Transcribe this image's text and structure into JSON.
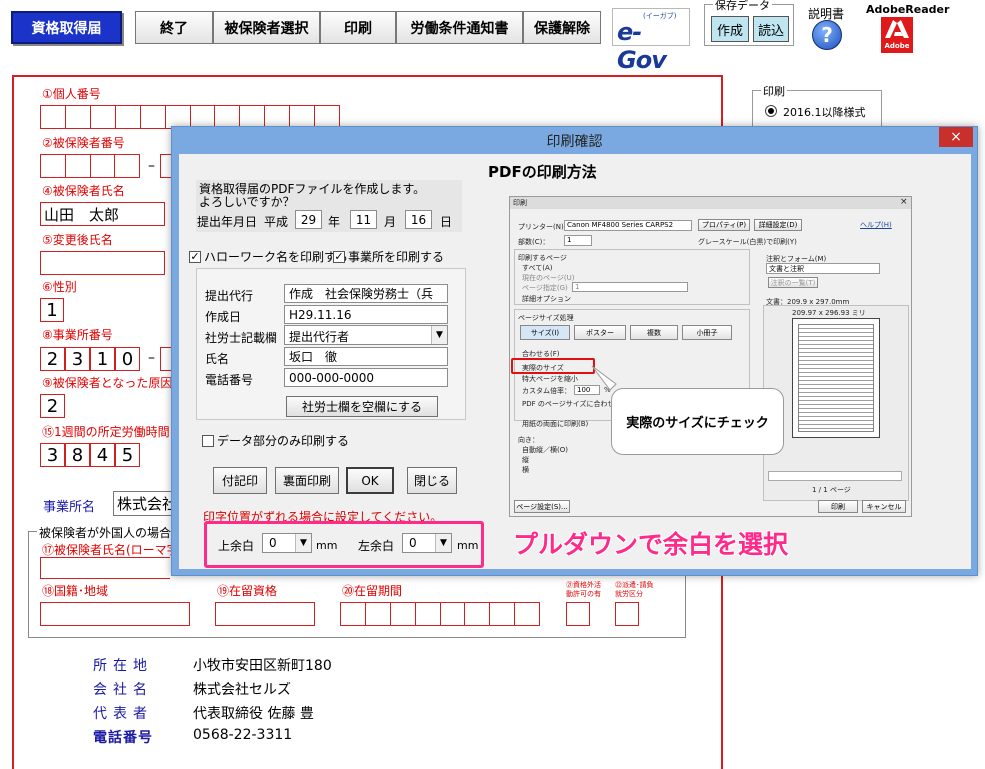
{
  "toolbar": {
    "active_tab": "資格取得届",
    "buttons": [
      "終了",
      "被保険者選択",
      "印刷",
      "労働条件通知書",
      "保護解除"
    ],
    "egov_logo": "e-Gov",
    "egov_sub": "(イーガブ)",
    "save_data_label": "保存データ",
    "create_label": "作成",
    "read_label": "読込",
    "manual_label": "説明書",
    "adobe_label": "AdobeReader",
    "adobe_sub": "Adobe"
  },
  "form": {
    "individual_number_label": "①個人番号",
    "insured_number_label": "②被保険者番号",
    "insured_name_label": "④被保険者氏名",
    "insured_name_value": "山田　太郎",
    "changed_name_label": "⑤変更後氏名",
    "gender_label": "⑥性別",
    "gender_value": "1",
    "office_number_label": "⑧事業所番号",
    "office_digits": [
      "2",
      "3",
      "1",
      "0"
    ],
    "reason_label": "⑨被保険者となった原因",
    "reason_value": "2",
    "weekly_hours_label": "⑮1週間の所定労働時間",
    "weekly_hours_digits": [
      "3",
      "8",
      "4",
      "5"
    ],
    "office_name_label": "事業所名",
    "office_name_value": "株式会社",
    "foreign_section_label": "被保険者が外国人の場合(",
    "roman_name_label": "⑰被保険者氏名(ローマ字",
    "nationality_label": "⑱国籍･地域",
    "residence_status_label": "⑲在留資格",
    "residence_period_label": "⑳在留期間",
    "activity_permit_label": "㉑資格外活動許可の有",
    "dispatch_label": "㉒派遣･請負就労区分"
  },
  "print_panel": {
    "title": "印刷",
    "option": "2016.1以降様式"
  },
  "company_info": [
    {
      "label": "所在地",
      "value": "小牧市安田区新町180"
    },
    {
      "label": "会社名",
      "value": "株式会社セルズ"
    },
    {
      "label": "代表者",
      "value": "代表取締役 佐藤 豊"
    },
    {
      "label": "電話番号",
      "value": "0568-22-3311"
    }
  ],
  "dialog": {
    "title": "印刷確認",
    "close_icon": "×",
    "prompt_line1": "資格取得届のPDFファイルを作成します。",
    "prompt_line2": "よろしいですか？",
    "date_label": "提出年月日",
    "era": "平成",
    "year": "29",
    "year_unit": "年",
    "month": "11",
    "month_unit": "月",
    "day": "16",
    "day_unit": "日",
    "print_hellowork_label": "ハローワーク名を印刷する",
    "print_office_label": "事業所を印刷する",
    "agent_label": "提出代行",
    "agent_value": "作成　社会保険労務士（兵",
    "created_label": "作成日",
    "created_value": "H29.11.16",
    "sr_field_label": "社労士記載欄",
    "sr_field_value": "提出代行者",
    "name_label": "氏名",
    "name_value": "坂口　徹",
    "phone_label": "電話番号",
    "phone_value": "000-000-0000",
    "clear_sr_button": "社労士欄を空欄にする",
    "data_only_label": "データ部分のみ印刷する",
    "buttons": {
      "attach": "付記印",
      "back_print": "裏面印刷",
      "ok": "OK",
      "close": "閉じる"
    },
    "offset_hint": "印字位置がずれる場合に設定してください。",
    "top_margin_label": "上余白",
    "top_margin_value": "0",
    "left_margin_label": "左余白",
    "left_margin_value": "0",
    "unit": "mm",
    "pdf_method_title": "PDFの印刷方法",
    "overlay_annotation": "プルダウンで余白を選択",
    "callout_text": "実際のサイズにチェック"
  },
  "acrobat_dialog": {
    "title": "印刷",
    "printer_label": "プリンター(N)：",
    "printer_value": "Canon MF4800 Series CARPS2",
    "properties_button": "プロパティ(P)",
    "advanced_button": "詳細設定(D)",
    "help_link": "ヘルプ(H)",
    "copies_label": "部数(C)：",
    "copies_value": "1",
    "grayscale_label": "グレースケール(白黒)で印刷(Y)",
    "pages_section": "印刷するページ",
    "page_all": "すべて(A)",
    "page_current": "現在のページ(U)",
    "page_specify": "ページ指定(G)",
    "page_specify_value": "1",
    "more_options": "詳細オプション",
    "size_section": "ページサイズ処理",
    "size_tabs": [
      "サイズ(I)",
      "ポスター",
      "複数",
      "小冊子"
    ],
    "fit": "合わせる(F)",
    "actual_size": "実際のサイズ",
    "shrink": "特大ページを縮小",
    "custom_scale": "カスタム倍率：",
    "custom_scale_value": "100",
    "percent": "%",
    "auto_size": "PDF のページサイズに合わせて用紙を選択(Z)",
    "duplex": "用紙の両面に印刷(B)",
    "orientation_section": "向き：",
    "orient_auto": "自動縦／横(O)",
    "orient_portrait": "縦",
    "orient_landscape": "横",
    "comments_section": "注釈とフォーム(M)",
    "comments_value": "文書と注釈",
    "comments_summary": "注釈の一覧(T)",
    "doc_size": "文書：209.9 x 297.0mm",
    "preview_size": "209.97 x 296.93 ミリ",
    "page_counter": "1 / 1 ページ",
    "page_setup_button": "ページ設定(S)...",
    "print_button": "印刷",
    "cancel_button": "キャンセル",
    "colors": {
      "highlight": "#e01010",
      "annotation": "#ff2a8a"
    }
  }
}
